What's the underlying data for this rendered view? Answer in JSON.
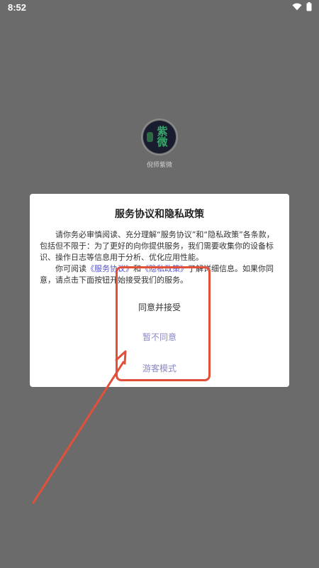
{
  "status_bar": {
    "time": "8:52"
  },
  "app": {
    "logo_text": "紫微",
    "name": "倪师紫微"
  },
  "dialog": {
    "title": "服务协议和隐私政策",
    "para1": "请你务必审慎阅读、充分理解“服务协议”和“隐私政策”各条款，包括但不限于：为了更好的向你提供服务，我们需要收集你的设备标识、操作日志等信息用于分析、优化应用性能。",
    "para2_prefix": "你可阅读",
    "link_service": "《服务协议》",
    "para2_and": "和",
    "link_privacy": "《隐私政策》",
    "para2_suffix": "了解详细信息。如果你同意，请点击下面按钮开始接受我们的服务。",
    "accept_label": "同意并接受",
    "decline_label": "暂不同意",
    "guest_label": "游客模式"
  },
  "colors": {
    "overlay": "#6b6b6b",
    "link": "#5555c8",
    "secondary_button": "#8a89c4",
    "annotation": "#e2503a"
  }
}
